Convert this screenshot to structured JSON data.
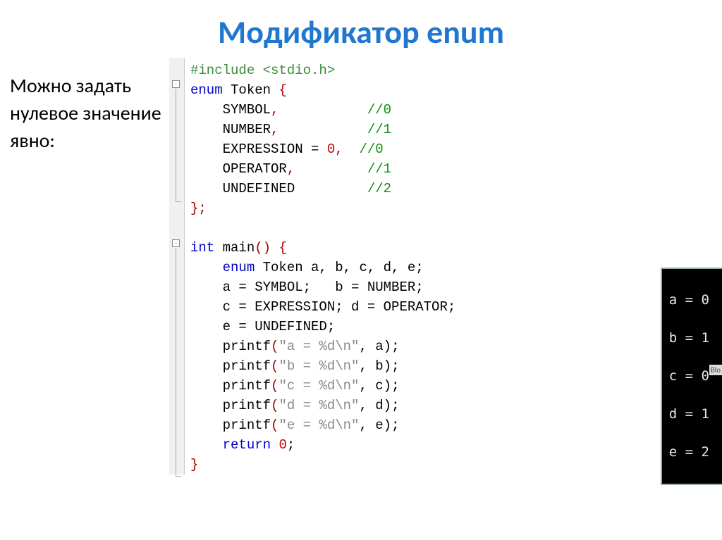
{
  "title": "Модификатор enum",
  "left_text": "Можно задать нулевое значение явно:",
  "code": {
    "l1": "#include <stdio.h>",
    "l2a": "enum",
    "l2b": " Token ",
    "l2c": "{",
    "l3a": "    SYMBOL",
    "l3b": ",",
    "l3c": "           ",
    "l3d": "//0",
    "l4a": "    NUMBER",
    "l4b": ",",
    "l4c": "           ",
    "l4d": "//1",
    "l5a": "    EXPRESSION ",
    "l5b": "= ",
    "l5c": "0",
    "l5d": ",",
    "l5e": "  ",
    "l5f": "//0",
    "l6a": "    OPERATOR",
    "l6b": ",",
    "l6c": "         ",
    "l6d": "//1",
    "l7a": "    UNDEFINED",
    "l7b": "",
    "l7c": "         ",
    "l7d": "//2",
    "l8": "};",
    "l10a": "int",
    "l10b": " main",
    "l10c": "() {",
    "l11a": "    ",
    "l11b": "enum",
    "l11c": " Token a, b, c, d, e;",
    "l12": "    a = SYMBOL;   b = NUMBER;",
    "l13": "    c = EXPRESSION; d = OPERATOR;",
    "l14": "    e = UNDEFINED;",
    "l15a": "    printf",
    "l15b": "(",
    "l15c": "\"a = %d\\n\"",
    "l15d": ", a);",
    "l16a": "    printf",
    "l16b": "(",
    "l16c": "\"b = %d\\n\"",
    "l16d": ", b);",
    "l17a": "    printf",
    "l17b": "(",
    "l17c": "\"c = %d\\n\"",
    "l17d": ", c);",
    "l18a": "    printf",
    "l18b": "(",
    "l18c": "\"d = %d\\n\"",
    "l18d": ", d);",
    "l19a": "    printf",
    "l19b": "(",
    "l19c": "\"e = %d\\n\"",
    "l19d": ", e);",
    "l20a": "    ",
    "l20b": "return",
    "l20c": " ",
    "l20d": "0",
    "l20e": ";",
    "l21": "}"
  },
  "console": {
    "r1": "a = 0",
    "r2": "b = 1",
    "r3": "c = 0",
    "r4": "d = 1",
    "r5": "e = 2"
  },
  "edge_label": "Blo"
}
